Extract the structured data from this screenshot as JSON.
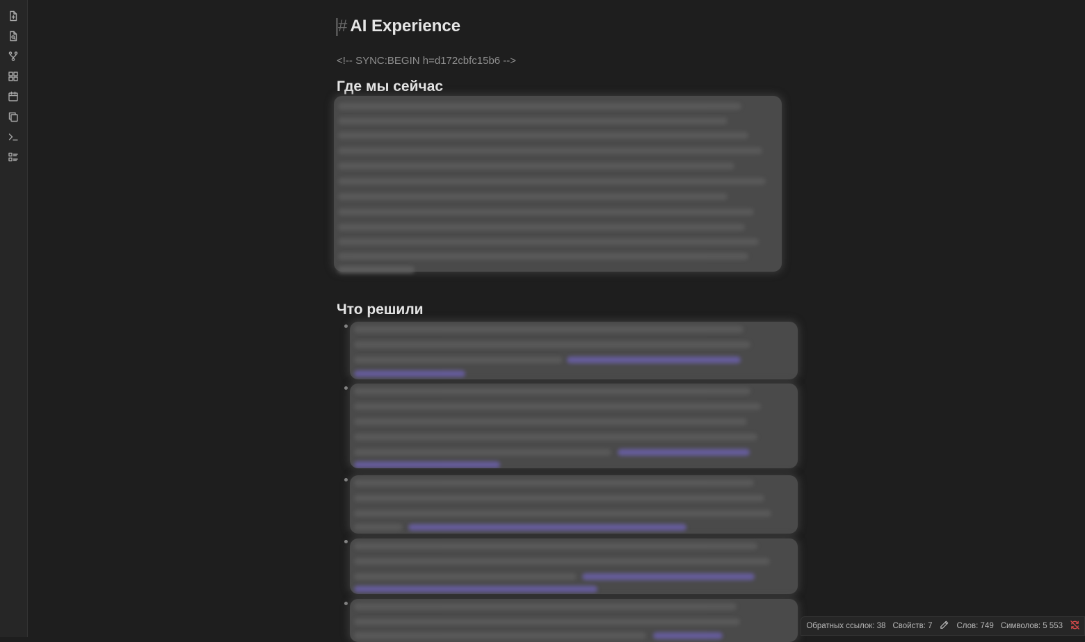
{
  "ribbon": {
    "icons": [
      "file-plus-icon",
      "file-search-icon",
      "git-branch-icon",
      "grid-icon",
      "calendar-icon",
      "copy-icon",
      "terminal-icon",
      "checklist-icon"
    ]
  },
  "note": {
    "hash": "#",
    "title": "AI Experience",
    "comment": "<!-- SYNC:BEGIN h=d172cbfc15b6 -->",
    "section1_heading": "Где мы сейчас",
    "section2_heading": "Что решили"
  },
  "statusbar": {
    "backlinks": "Обратных ссылок: 38",
    "properties": "Свойств: 7",
    "words": "Слов: 749",
    "chars": "Символов: 5 553",
    "colors": {
      "sync_error": "#d44a4a"
    }
  },
  "colors": {
    "background": "#1e1e1e",
    "ribbon": "#262626",
    "heading": "#e6e6e6",
    "comment": "#8f8f8f",
    "link": "#6a5fa8"
  }
}
